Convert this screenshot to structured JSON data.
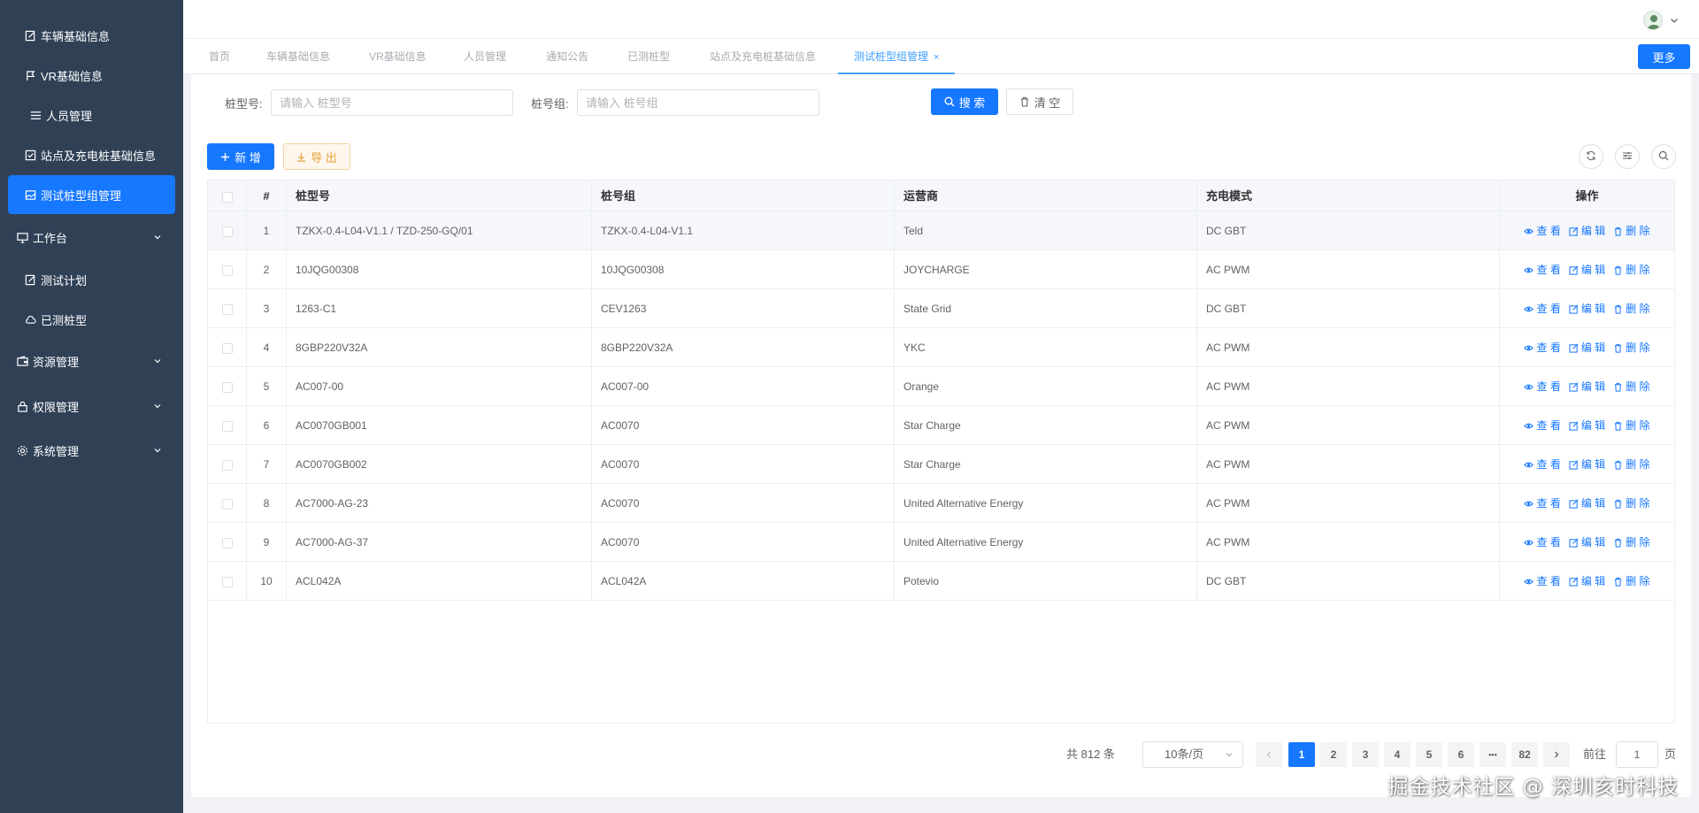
{
  "sidebar": {
    "items": [
      {
        "label": "车辆基础信息",
        "icon": "edit-doc-icon"
      },
      {
        "label": "VR基础信息",
        "icon": "flag-icon"
      },
      {
        "label": "人员管理",
        "icon": "list-icon"
      },
      {
        "label": "站点及充电桩基础信息",
        "icon": "checkbox-icon"
      },
      {
        "label": "测试桩型组管理",
        "icon": "image-icon",
        "active": true
      },
      {
        "label": "工作台",
        "icon": "monitor-icon",
        "expandable": true
      },
      {
        "label": "测试计划",
        "icon": "edit-doc-icon"
      },
      {
        "label": "已测桩型",
        "icon": "cloud-icon"
      },
      {
        "label": "资源管理",
        "icon": "wallet-icon",
        "expandable": true
      },
      {
        "label": "权限管理",
        "icon": "lock-icon",
        "expandable": true
      },
      {
        "label": "系统管理",
        "icon": "gear-icon",
        "expandable": true
      }
    ]
  },
  "tabs": [
    {
      "label": "首页"
    },
    {
      "label": "车辆基础信息"
    },
    {
      "label": "VR基础信息"
    },
    {
      "label": "人员管理"
    },
    {
      "label": "通知公告"
    },
    {
      "label": "已测桩型"
    },
    {
      "label": "站点及充电桩基础信息"
    },
    {
      "label": "测试桩型组管理",
      "active": true
    }
  ],
  "tab_close": "×",
  "more_label": "更多",
  "search": {
    "model_label": "桩型号:",
    "model_placeholder": "请输入 桩型号",
    "group_label": "桩号组:",
    "group_placeholder": "请输入 桩号组",
    "search_label": "搜 索",
    "clear_label": "清 空"
  },
  "toolbar": {
    "add_label": "新 增",
    "export_label": "导 出"
  },
  "table": {
    "headers": {
      "index": "#",
      "model": "桩型号",
      "group": "桩号组",
      "operator": "运营商",
      "mode": "充电模式",
      "actions": "操作"
    },
    "action_labels": {
      "view": "查 看",
      "edit": "编 辑",
      "delete": "删 除"
    },
    "rows": [
      {
        "index": "1",
        "model": "TZKX-0.4-L04-V1.1 / TZD-250-GQ/01",
        "group": "TZKX-0.4-L04-V1.1",
        "operator": "Teld",
        "mode": "DC GBT"
      },
      {
        "index": "2",
        "model": "10JQG00308",
        "group": "10JQG00308",
        "operator": "JOYCHARGE",
        "mode": "AC PWM"
      },
      {
        "index": "3",
        "model": "1263-C1",
        "group": "CEV1263",
        "operator": "State Grid",
        "mode": "DC GBT"
      },
      {
        "index": "4",
        "model": "8GBP220V32A",
        "group": "8GBP220V32A",
        "operator": "YKC",
        "mode": "AC PWM"
      },
      {
        "index": "5",
        "model": "AC007-00",
        "group": "AC007-00",
        "operator": "Orange",
        "mode": "AC PWM"
      },
      {
        "index": "6",
        "model": "AC0070GB001",
        "group": "AC0070",
        "operator": "Star Charge",
        "mode": "AC PWM"
      },
      {
        "index": "7",
        "model": "AC0070GB002",
        "group": "AC0070",
        "operator": "Star Charge",
        "mode": "AC PWM"
      },
      {
        "index": "8",
        "model": "AC7000-AG-23",
        "group": "AC0070",
        "operator": "United Alternative Energy",
        "mode": "AC PWM"
      },
      {
        "index": "9",
        "model": "AC7000-AG-37",
        "group": "AC0070",
        "operator": "United Alternative Energy",
        "mode": "AC PWM"
      },
      {
        "index": "10",
        "model": "ACL042A",
        "group": "ACL042A",
        "operator": "Potevio",
        "mode": "DC GBT"
      }
    ]
  },
  "pagination": {
    "total": "共 812 条",
    "page_size": "10条/页",
    "pages": [
      "1",
      "2",
      "3",
      "4",
      "5",
      "6"
    ],
    "ellipsis": "•••",
    "last_page": "82",
    "current": "1",
    "jump_label": "前往",
    "jump_value": "1",
    "jump_suffix": "页"
  },
  "watermark": "掘金技术社区 @ 深圳亥时科技",
  "colors": {
    "sidebar_bg": "#304156",
    "primary": "#1677ff",
    "warning": "#e6a23c"
  }
}
